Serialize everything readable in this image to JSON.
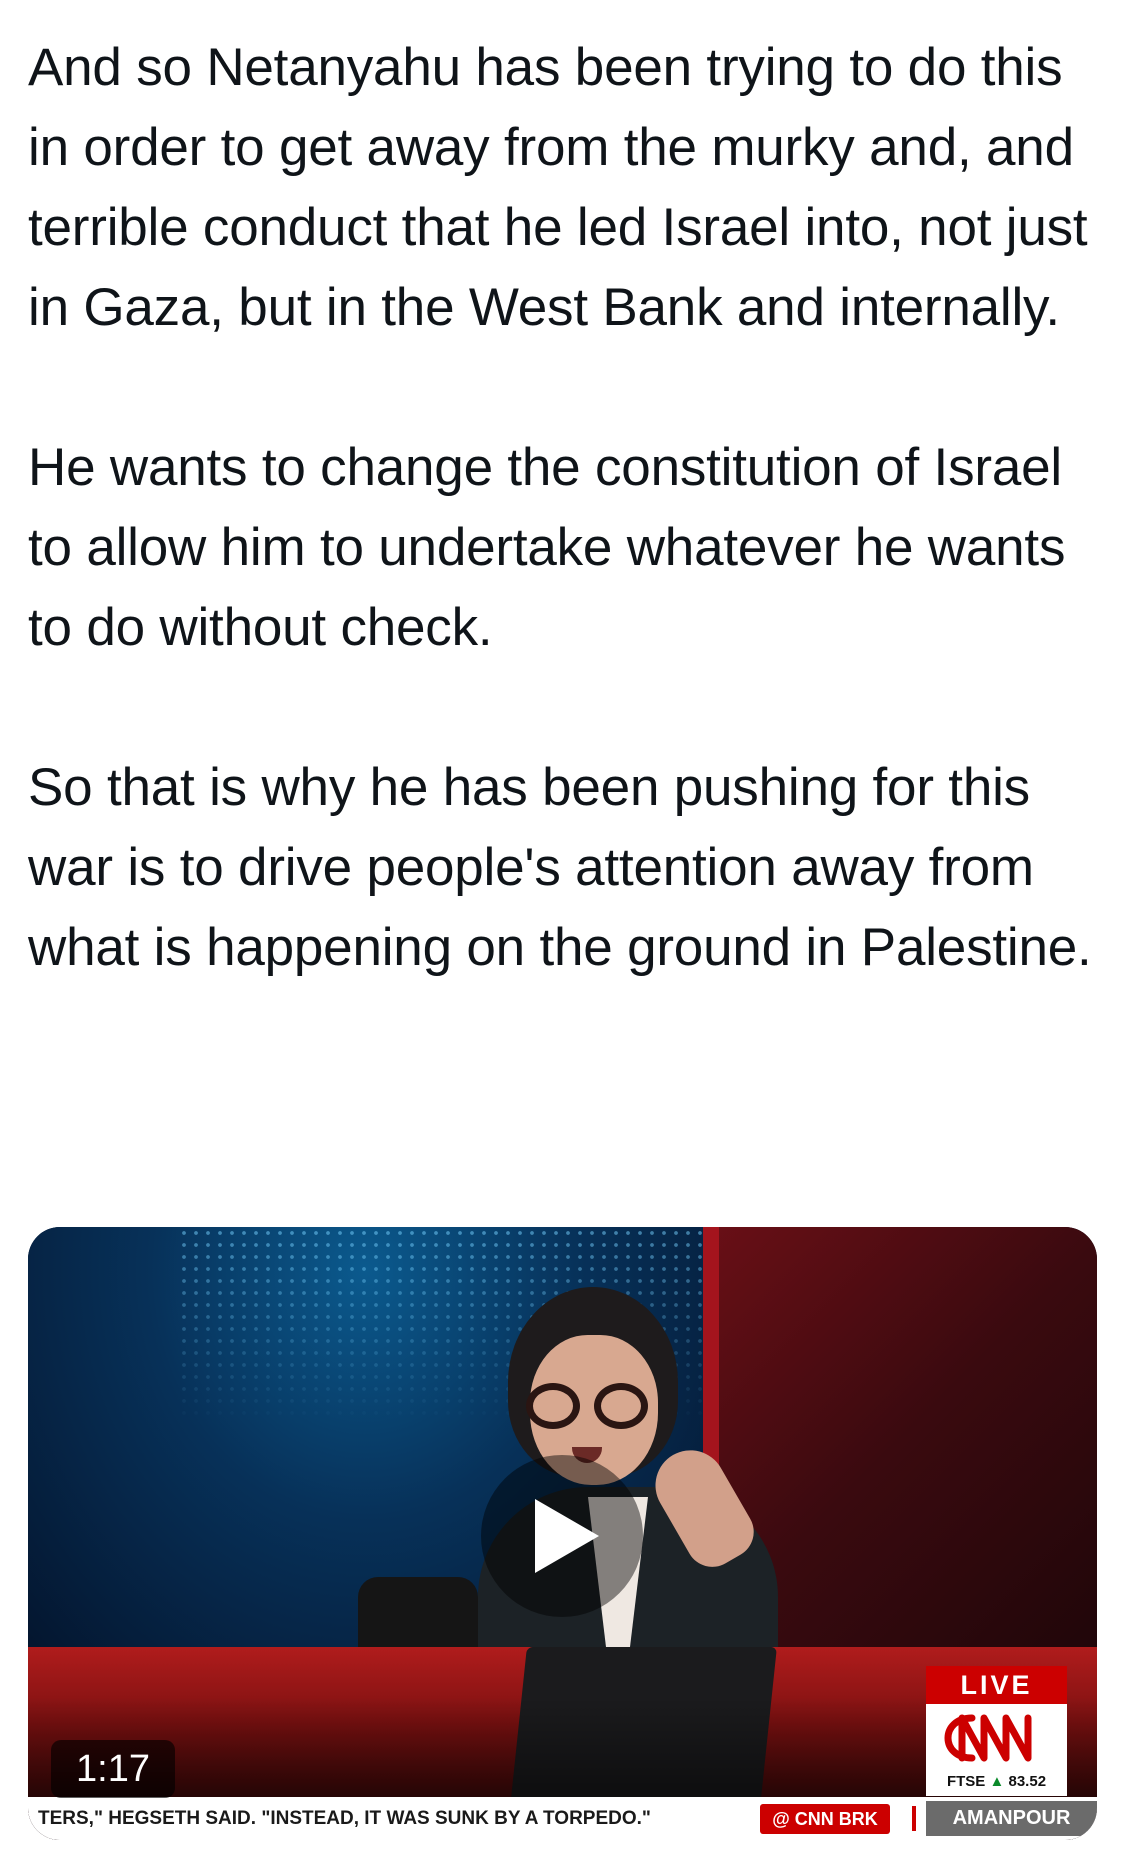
{
  "tweet": {
    "paragraphs": [
      "And so Netanyahu has been trying to do this in order to get away from the murky and, and terrible conduct that he led Israel into, not just in Gaza, but in the West Bank and internally.",
      "He wants to change the constitution of Israel to allow him to undertake whatever he wants to do without check.",
      "So that is why he has been pushing for this war is to drive people's attention away from what is happening on the ground in Palestine."
    ]
  },
  "video": {
    "duration": "1:17",
    "live_label": "LIVE",
    "network_logo": "CNN",
    "market_ticker": {
      "label": "FTSE",
      "arrow": "▲",
      "value": "83.52"
    },
    "crawl_text": "TERS,\" HEGSETH SAID. \"INSTEAD, IT WAS SUNK BY A TORPEDO.\"",
    "brk_tag": "@ CNN BRK",
    "show_name": "AMANPOUR",
    "colors": {
      "cnn_red": "#cc0000",
      "show_tag_gray": "#6b6b6b"
    }
  }
}
